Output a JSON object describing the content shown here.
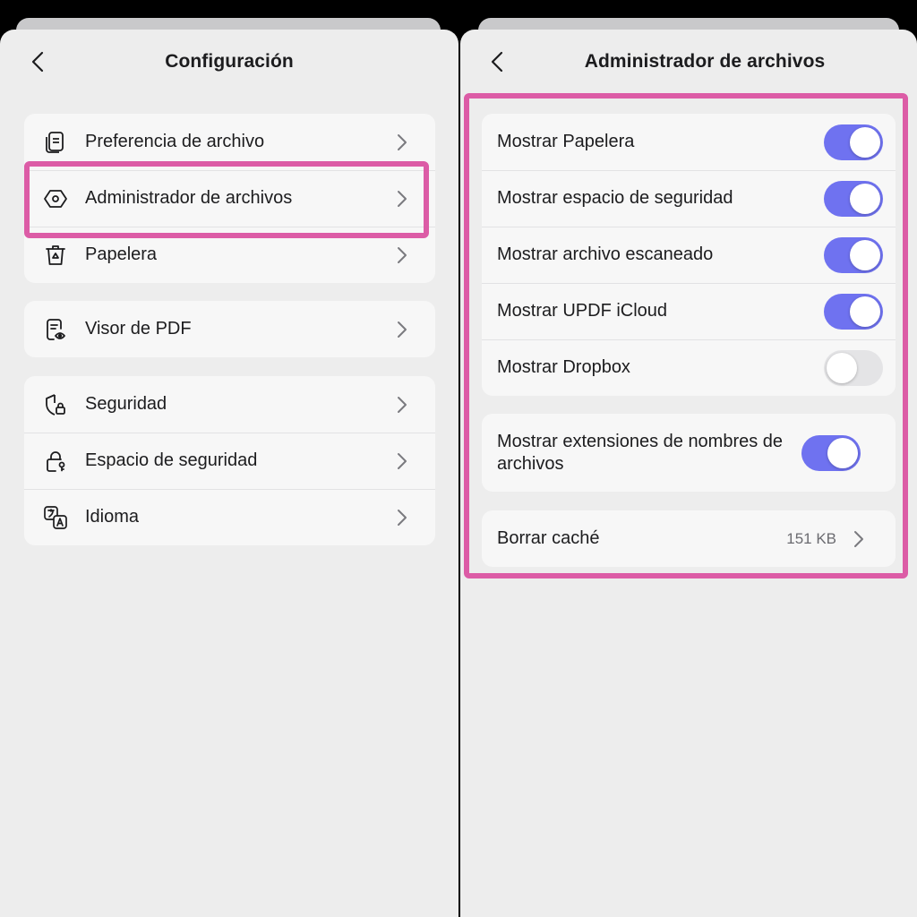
{
  "left": {
    "title": "Configuración",
    "groups": [
      {
        "items": [
          {
            "label": "Preferencia de archivo",
            "icon": "document-stack-icon"
          },
          {
            "label": "Administrador de archivos",
            "icon": "hexagon-gear-icon"
          },
          {
            "label": "Papelera",
            "icon": "trash-icon"
          }
        ]
      },
      {
        "items": [
          {
            "label": "Visor de PDF",
            "icon": "document-eye-icon"
          }
        ]
      },
      {
        "items": [
          {
            "label": "Seguridad",
            "icon": "shield-lock-icon"
          },
          {
            "label": "Espacio de seguridad",
            "icon": "lock-key-icon"
          },
          {
            "label": "Idioma",
            "icon": "translate-icon"
          }
        ]
      }
    ]
  },
  "right": {
    "title": "Administrador de archivos",
    "toggles": [
      {
        "label": "Mostrar Papelera",
        "on": true
      },
      {
        "label": "Mostrar espacio de seguridad",
        "on": true
      },
      {
        "label": "Mostrar archivo escaneado",
        "on": true
      },
      {
        "label": "Mostrar UPDF iCloud",
        "on": true
      },
      {
        "label": "Mostrar Dropbox",
        "on": false
      }
    ],
    "extensions": {
      "label": "Mostrar extensiones de nombres de archivos",
      "on": true
    },
    "cache": {
      "label": "Borrar caché",
      "value": "151 KB"
    }
  },
  "colors": {
    "accent": "#6f72f0",
    "highlight": "#dc5ca6",
    "background": "#ededed",
    "card": "#f7f7f7"
  }
}
